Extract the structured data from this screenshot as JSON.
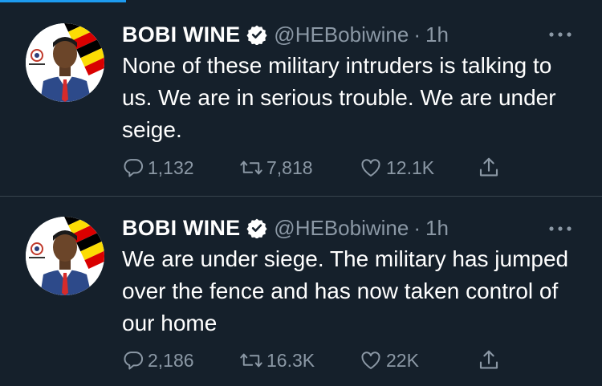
{
  "tweets": [
    {
      "author_name": "BOBI WINE",
      "handle": "@HEBobiwine",
      "separator": "·",
      "time": "1h",
      "text": "None of these military intruders is talking to us. We are in serious trouble. We are under seige.",
      "replies": "1,132",
      "retweets": "7,818",
      "likes": "12.1K"
    },
    {
      "author_name": "BOBI WINE",
      "handle": "@HEBobiwine",
      "separator": "·",
      "time": "1h",
      "text": "We are under siege. The military has jumped over the fence and has now taken control of our home",
      "replies": "2,186",
      "retweets": "16.3K",
      "likes": "22K"
    }
  ],
  "icons": {
    "verified": "verified-badge-icon",
    "more": "more-options-icon",
    "reply": "reply-icon",
    "retweet": "retweet-icon",
    "like": "heart-icon",
    "share": "share-icon"
  },
  "colors": {
    "background": "#15202b",
    "text": "#ffffff",
    "secondary": "#8b98a5",
    "divider": "#38444d",
    "accent": "#1d9bf0"
  }
}
